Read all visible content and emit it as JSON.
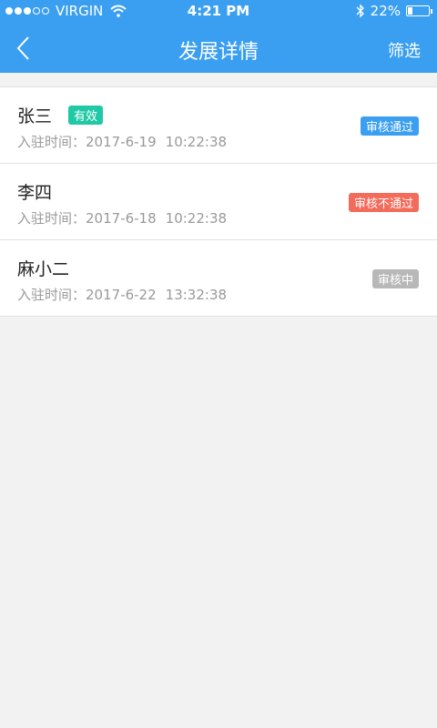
{
  "status_bar": {
    "carrier": "VIRGIN",
    "time": "4:21 PM",
    "battery": "22%",
    "battery_level": 0.22
  },
  "navbar": {
    "title": "发展详情",
    "filter_label": "筛选",
    "background": "#3a9ff0"
  },
  "rows": [
    {
      "name": "张三",
      "tag": "有效",
      "time_label": "入驻时间：",
      "date": "2017-6-19",
      "clock": "10:22:38",
      "status": "审核通过",
      "status_color": "#3a9ff0"
    },
    {
      "name": "李四",
      "time_label": "入驻时间：",
      "date": "2017-6-18",
      "clock": "10:22:38",
      "status": "审核不通过",
      "status_color": "#f26b5b"
    },
    {
      "name": "麻小二",
      "time_label": "入驻时间：",
      "date": "2017-6-22",
      "clock": "13:32:38",
      "status": "审核中",
      "status_color": "#b8b8b8"
    }
  ],
  "colors": {
    "valid_tag": "#1fc9a5",
    "page_background": "#f2f2f2"
  },
  "icons": {
    "back": "chevron-left-icon",
    "wifi": "wifi-icon",
    "bluetooth": "bluetooth-icon"
  }
}
